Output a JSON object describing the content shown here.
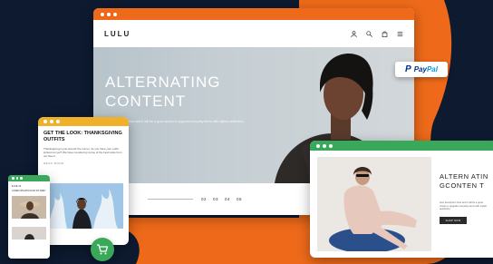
{
  "colors": {
    "background": "#0d1a30",
    "orange": "#ee6a1a",
    "yellow": "#f0b12a",
    "green": "#3aa85a"
  },
  "main_window": {
    "logo": "LULU",
    "header_icons": [
      "user-icon",
      "search-icon",
      "bag-icon",
      "menu-icon"
    ],
    "hero_title": "ALTERNATING\nCONTENT",
    "hero_desc": "Item description here and it will be a good choice to upgrade everyday items with stylish aesthetics",
    "pager": [
      "02",
      "03",
      "04",
      "05"
    ]
  },
  "paypal": {
    "mark": "P",
    "pay": "Pay",
    "pal": "Pal"
  },
  "blog_window": {
    "title": "GET THE LOOK: THANKSGIVING OUTFITS",
    "text": "Thanksgiving is just around the corner, do you have your outfit picked out yet? We have rounded up some of the best looks from our favori...",
    "read_more": "READ MORE"
  },
  "mobile_window": {
    "logo": "LULU",
    "text": "Lorem ipsum dolor sit amet"
  },
  "product_window": {
    "title": "ALTERN ATINGCONTEN T",
    "text": "Item description here and it will be a good choice to upgrade everyday items with stylish aesthetics",
    "button": "SHOP NOW"
  }
}
